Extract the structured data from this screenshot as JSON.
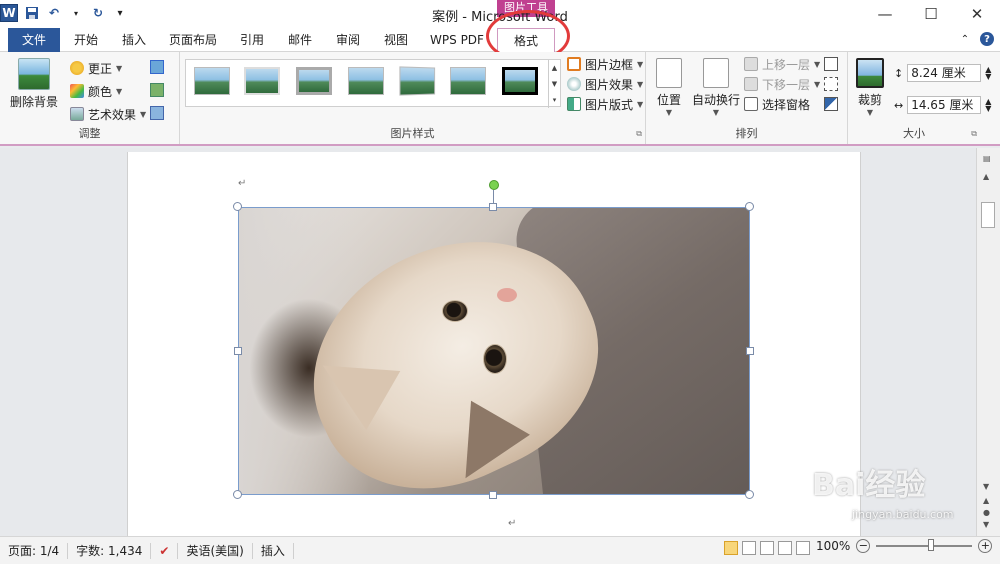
{
  "window": {
    "title": "案例 - Microsoft Word",
    "context_header": "图片工具",
    "min_glyph": "—",
    "max_glyph": "☐",
    "close_glyph": "✕"
  },
  "quick_access": {
    "save_icon": "save-icon",
    "undo_glyph": "↶",
    "redo_glyph": "↻",
    "customize_glyph": "▾"
  },
  "tabs": [
    {
      "label": "文件"
    },
    {
      "label": "开始"
    },
    {
      "label": "插入"
    },
    {
      "label": "页面布局"
    },
    {
      "label": "引用"
    },
    {
      "label": "邮件"
    },
    {
      "label": "审阅"
    },
    {
      "label": "视图"
    },
    {
      "label": "WPS PDF"
    },
    {
      "label": "格式"
    }
  ],
  "ribbon": {
    "adjust": {
      "label": "调整",
      "remove_bg": "删除背景",
      "corrections": "更正",
      "color": "颜色",
      "artistic": "艺术效果"
    },
    "styles": {
      "label": "图片样式",
      "border": "图片边框",
      "effects": "图片效果",
      "layout": "图片版式"
    },
    "arrange": {
      "label": "排列",
      "position": "位置",
      "wrap": "自动换行",
      "bring_forward": "上移一层",
      "send_backward": "下移一层",
      "selection_pane": "选择窗格"
    },
    "size": {
      "label": "大小",
      "crop": "裁剪",
      "height": "8.24 厘米",
      "width": "14.65 厘米"
    }
  },
  "status": {
    "page": "页面: 1/4",
    "words": "字数: 1,434",
    "language": "英语(美国)",
    "mode": "插入",
    "zoom": "100%"
  },
  "watermark": {
    "brand": "Bai经验",
    "url": "jingyan.baidu.com"
  },
  "colors": {
    "word_blue": "#2b579a",
    "context_pink": "#c04090",
    "highlight_red": "#e23b3b"
  }
}
